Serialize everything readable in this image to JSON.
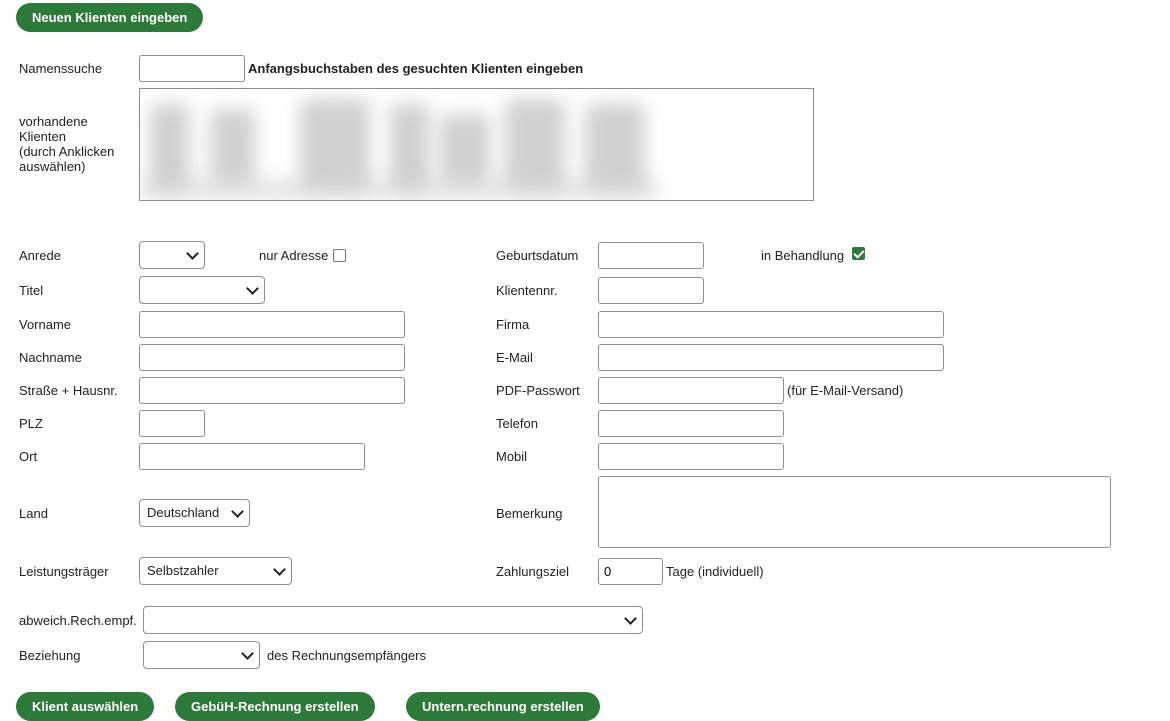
{
  "buttons": {
    "new_client": "Neuen Klienten eingeben",
    "select_client": "Klient auswählen",
    "gebueh_invoice": "GebüH-Rechnung erstellen",
    "company_invoice": "Untern.rechnung erstellen"
  },
  "search": {
    "label": "Namenssuche",
    "value": "",
    "hint": "Anfangsbuchstaben des gesuchten Klienten eingeben"
  },
  "client_list": {
    "label_line1": "vorhandene",
    "label_line2": "Klienten",
    "label_line3": "(durch Anklicken",
    "label_line4": "auswählen)"
  },
  "form": {
    "anrede": {
      "label": "Anrede",
      "value": ""
    },
    "nur_adresse": {
      "label": "nur Adresse",
      "checked": false
    },
    "geburtsdatum": {
      "label": "Geburtsdatum",
      "value": ""
    },
    "in_behandlung": {
      "label": "in Behandlung",
      "checked": true
    },
    "titel": {
      "label": "Titel",
      "value": ""
    },
    "klientennr": {
      "label": "Klientennr.",
      "value": ""
    },
    "vorname": {
      "label": "Vorname",
      "value": ""
    },
    "firma": {
      "label": "Firma",
      "value": ""
    },
    "nachname": {
      "label": "Nachname",
      "value": ""
    },
    "email": {
      "label": "E-Mail",
      "value": ""
    },
    "strasse": {
      "label": "Straße + Hausnr.",
      "value": ""
    },
    "pdf_passwort": {
      "label": "PDF-Passwort",
      "value": "",
      "hint": "(für E-Mail-Versand)"
    },
    "plz": {
      "label": "PLZ",
      "value": ""
    },
    "telefon": {
      "label": "Telefon",
      "value": ""
    },
    "ort": {
      "label": "Ort",
      "value": ""
    },
    "mobil": {
      "label": "Mobil",
      "value": ""
    },
    "land": {
      "label": "Land",
      "value": "Deutschland"
    },
    "bemerkung": {
      "label": "Bemerkung",
      "value": ""
    },
    "leistungstraeger": {
      "label": "Leistungsträger",
      "value": "Selbstzahler"
    },
    "zahlungsziel": {
      "label": "Zahlungsziel",
      "value": "0",
      "hint": "Tage (individuell)"
    },
    "abweich_rech": {
      "label": "abweich.Rech.empf.",
      "value": ""
    },
    "beziehung": {
      "label": "Beziehung",
      "value": "",
      "hint": "des Rechnungsempfängers"
    }
  },
  "colors": {
    "accent": "#2d7a3a"
  }
}
